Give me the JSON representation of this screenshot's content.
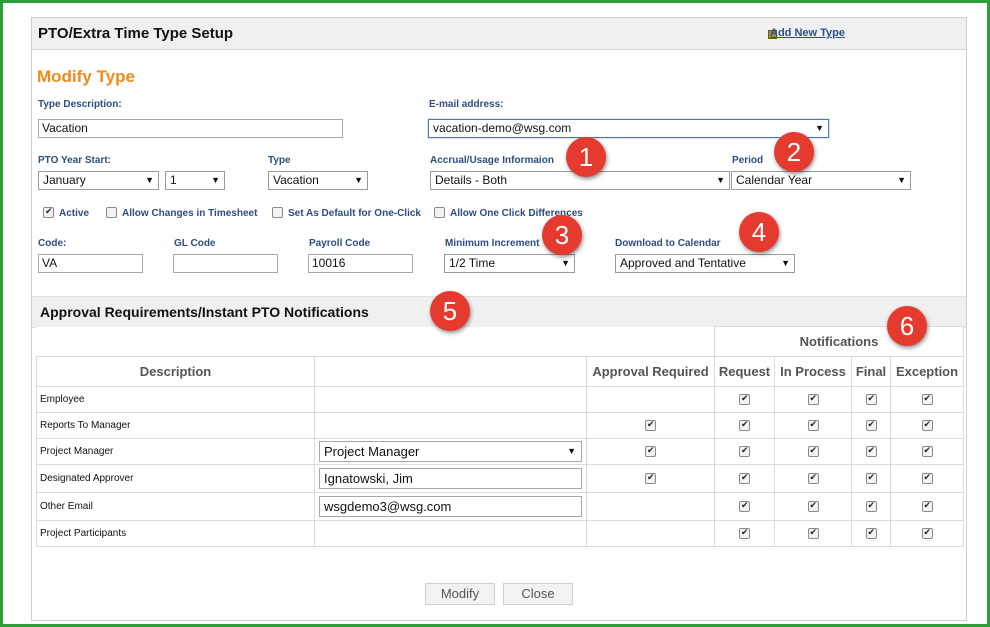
{
  "header": {
    "title": "PTO/Extra Time Type Setup",
    "add_new_type": "Add New Type"
  },
  "form": {
    "heading": "Modify Type",
    "type_description": {
      "label": "Type Description:",
      "value": "Vacation"
    },
    "email": {
      "label": "E-mail address:",
      "value": "vacation-demo@wsg.com"
    },
    "pto_year_start": {
      "label": "PTO Year Start:",
      "month": "January",
      "day": "1"
    },
    "type": {
      "label": "Type",
      "value": "Vacation"
    },
    "accrual": {
      "label": "Accrual/Usage Informaion",
      "value": "Details - Both"
    },
    "period": {
      "label": "Period",
      "value": "Calendar Year"
    },
    "checkboxes": [
      {
        "label": "Active",
        "checked": true
      },
      {
        "label": "Allow Changes in Timesheet",
        "checked": false
      },
      {
        "label": "Set As Default for One-Click",
        "checked": false
      },
      {
        "label": "Allow One Click Differences",
        "checked": false
      }
    ],
    "code": {
      "label": "Code:",
      "value": "VA"
    },
    "gl_code": {
      "label": "GL Code",
      "value": ""
    },
    "payroll_code": {
      "label": "Payroll Code",
      "value": "10016"
    },
    "minimum_increment": {
      "label": "Minimum Increment",
      "value": "1/2 Time"
    },
    "download_calendar": {
      "label": "Download to Calendar",
      "value": "Approved and Tentative"
    }
  },
  "badges": [
    "1",
    "2",
    "3",
    "4",
    "5",
    "6"
  ],
  "approvals": {
    "title": "Approval Requirements/Instant PTO Notifications",
    "notifications_header": "Notifications",
    "columns": {
      "description": "Description",
      "approval_required": "Approval Required",
      "request": "Request",
      "in_process": "In Process",
      "final": "Final",
      "exception": "Exception"
    },
    "rows": [
      {
        "description": "Employee",
        "field": "",
        "field_type": "none",
        "approval": false,
        "approval_box": false,
        "request": true,
        "in_process": true,
        "final": true,
        "exception": true
      },
      {
        "description": "Reports To Manager",
        "field": "",
        "field_type": "none",
        "approval": true,
        "approval_box": true,
        "request": true,
        "in_process": true,
        "final": true,
        "exception": true
      },
      {
        "description": "Project Manager",
        "field": "Project Manager",
        "field_type": "select",
        "approval": true,
        "approval_box": true,
        "request": true,
        "in_process": true,
        "final": true,
        "exception": true
      },
      {
        "description": "Designated Approver",
        "field": "Ignatowski, Jim",
        "field_type": "text",
        "approval": true,
        "approval_box": true,
        "request": true,
        "in_process": true,
        "final": true,
        "exception": true
      },
      {
        "description": "Other Email",
        "field": "wsgdemo3@wsg.com",
        "field_type": "text",
        "approval": false,
        "approval_box": false,
        "request": true,
        "in_process": true,
        "final": true,
        "exception": true
      },
      {
        "description": "Project Participants",
        "field": "",
        "field_type": "none",
        "approval": false,
        "approval_box": false,
        "request": true,
        "in_process": true,
        "final": true,
        "exception": true
      }
    ]
  },
  "buttons": {
    "modify": "Modify",
    "close": "Close"
  },
  "colors": {
    "frame_border": "#2e9e3a",
    "heading": "#f28a1a",
    "label": "#2d4e7e",
    "badge": "#e53a2e"
  }
}
